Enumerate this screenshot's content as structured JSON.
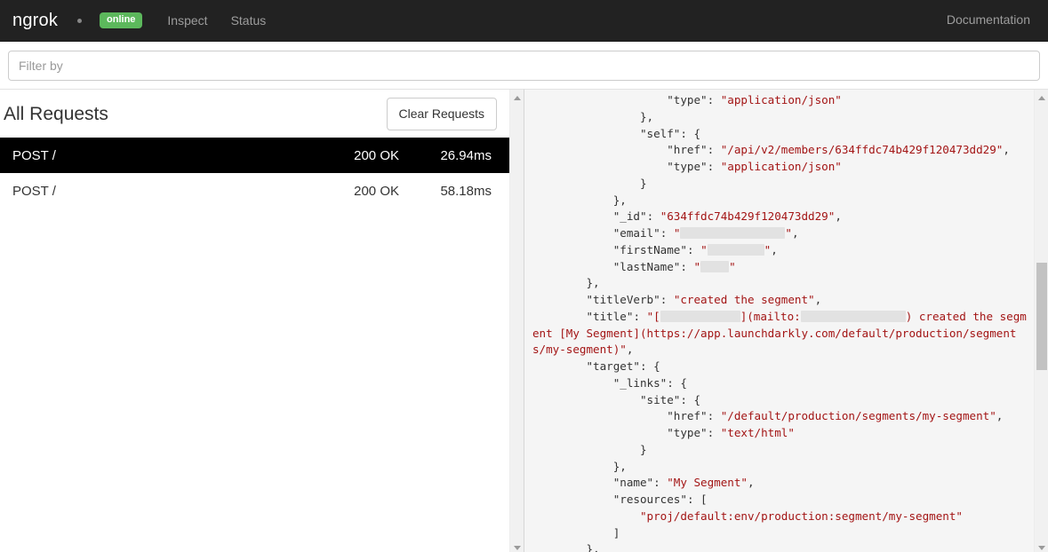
{
  "navbar": {
    "brand": "ngrok",
    "status_dot": "•",
    "online_badge": "online",
    "links": [
      {
        "label": "Inspect",
        "name": "nav-link-inspect"
      },
      {
        "label": "Status",
        "name": "nav-link-status"
      }
    ],
    "documentation": "Documentation"
  },
  "filter": {
    "placeholder": "Filter by",
    "value": ""
  },
  "requests_panel": {
    "title": "All Requests",
    "clear_button": "Clear Requests",
    "rows": [
      {
        "method": "POST /",
        "status": "200 OK",
        "duration": "26.94ms",
        "selected": true
      },
      {
        "method": "POST /",
        "status": "200 OK",
        "duration": "58.18ms",
        "selected": false
      }
    ]
  },
  "inspector": {
    "json_lines": [
      "                    \"type\": \"application/json\"",
      "                },",
      "                \"self\": {",
      "                    \"href\": \"/api/v2/members/634ffdc74b429f120473dd29\",",
      "                    \"type\": \"application/json\"",
      "                }",
      "            },",
      "            \"_id\": \"634ffdc74b429f120473dd29\",",
      "            \"email\": \"[redacted]\",",
      "            \"firstName\": \"[redacted]\",",
      "            \"lastName\": \"[redacted]\"",
      "        },",
      "        \"titleVerb\": \"created the segment\",",
      "        \"title\": \"[[redacted]](mailto:[redacted]) created the segment [My Segment](https://app.launchdarkly.com/default/production/segments/my-segment)\",",
      "        \"target\": {",
      "            \"_links\": {",
      "                \"site\": {",
      "                    \"href\": \"/default/production/segments/my-segment\",",
      "                    \"type\": \"text/html\"",
      "                }",
      "            },",
      "            \"name\": \"My Segment\",",
      "            \"resources\": [",
      "                \"proj/default:env/production:segment/my-segment\"",
      "            ]",
      "        },"
    ],
    "member_id": "634ffdc74b429f120473dd29",
    "member_href": "/api/v2/members/634ffdc74b429f120473dd29",
    "content_type": "application/json",
    "title_verb": "created the segment",
    "segment_name": "My Segment",
    "segment_site_href": "/default/production/segments/my-segment",
    "segment_site_type": "text/html",
    "segment_resource": "proj/default:env/production:segment/my-segment",
    "segment_url": "https://app.launchdarkly.com/default/production/segments/my-segment"
  },
  "colors": {
    "navbar_bg": "#222222",
    "online_green": "#5cb85c",
    "selected_row_bg": "#000000",
    "json_string": "#a31515",
    "panel_bg": "#f5f5f5"
  }
}
